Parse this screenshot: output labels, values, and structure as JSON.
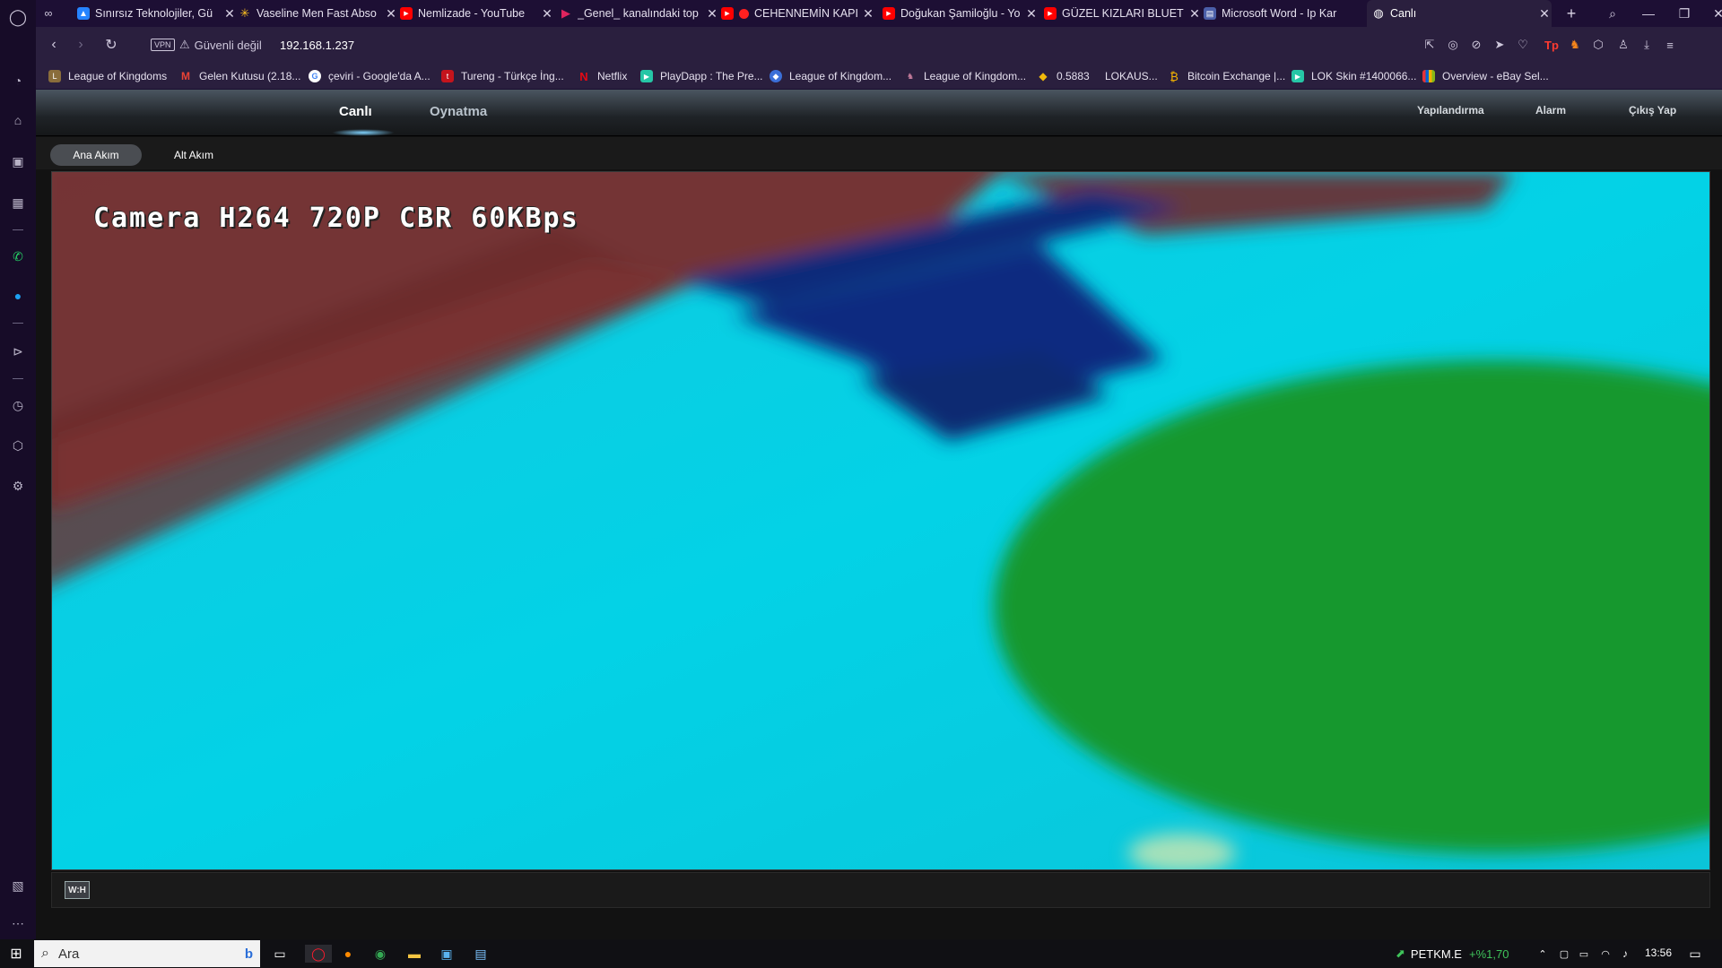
{
  "browser": {
    "tabs": [
      {
        "title": "Sınırsız Teknolojiler, Gü",
        "favicon": "atlassian-icon",
        "color": "#2684ff"
      },
      {
        "title": "Vaseline Men Fast Abso",
        "favicon": "walmart-icon",
        "color": "#ffc220"
      },
      {
        "title": "Nemlizade - YouTube",
        "favicon": "youtube-icon",
        "color": "#ff0000"
      },
      {
        "title": "_Genel_ kanalındaki top",
        "favicon": "play-icon",
        "color": "#e0245e"
      },
      {
        "title": "CEHENNEMİN KAPI",
        "favicon": "youtube-icon",
        "color": "#ff0000"
      },
      {
        "title": "Doğukan Şamiloğlu - Yo",
        "favicon": "youtube-icon",
        "color": "#ff0000"
      },
      {
        "title": "GÜZEL KIZLARI BLUETO",
        "favicon": "youtube-icon",
        "color": "#ff0000"
      },
      {
        "title": "Microsoft Word - Ip Kar",
        "favicon": "document-icon",
        "color": "#4b5fa8"
      },
      {
        "title": "Canlı",
        "favicon": "globe-icon",
        "color": "#ffffff",
        "active": true
      }
    ],
    "address": {
      "security_label": "Güvenli değil",
      "url": "192.168.1.237",
      "vpn_label": "VPN"
    },
    "bookmarks": [
      {
        "label": "League of Kingdoms",
        "color": "#8a6d3b",
        "glyph": "L"
      },
      {
        "label": "Gelen Kutusu (2.18...",
        "color": "#ea4335",
        "glyph": "M"
      },
      {
        "label": "çeviri - Google'da A...",
        "color": "#4285f4",
        "glyph": "G"
      },
      {
        "label": "Tureng - Türkçe İng...",
        "color": "#c4141c",
        "glyph": "t"
      },
      {
        "label": "Netflix",
        "color": "#e50914",
        "glyph": "N"
      },
      {
        "label": "PlayDapp : The Pre...",
        "color": "#26c6a6",
        "glyph": "▶"
      },
      {
        "label": "League of Kingdom...",
        "color": "#3b6fd8",
        "glyph": "◆"
      },
      {
        "label": "League of Kingdom...",
        "color": "#7a3b5a",
        "glyph": "♞"
      },
      {
        "label": "0.5883",
        "color": "#f0b90b",
        "glyph": "◆"
      },
      {
        "label": "LOKAUS...",
        "color": "#2a1f3e",
        "glyph": ""
      },
      {
        "label": "Bitcoin Exchange |...",
        "color": "#f5b400",
        "glyph": "₿"
      },
      {
        "label": "LOK Skin #1400066...",
        "color": "#26c6a6",
        "glyph": "▶"
      },
      {
        "label": "Overview - eBay Sel...",
        "color": "#86b817",
        "glyph": "e"
      }
    ]
  },
  "camera_app": {
    "nav": {
      "live": "Canlı",
      "playback": "Oynatma",
      "config": "Yapılandırma",
      "alarm": "Alarm",
      "logout": "Çıkış Yap"
    },
    "streams": {
      "main": "Ana Akım",
      "sub": "Alt Akım"
    },
    "osd_text": "Camera H264 720P CBR 60KBps",
    "wh_button": "W:H"
  },
  "taskbar": {
    "search_placeholder": "Ara",
    "ticker_symbol": "PETKM.E",
    "ticker_change": "+%1,70",
    "clock": "13:56",
    "colors": {
      "ticker_up": "#3fc35a"
    }
  }
}
